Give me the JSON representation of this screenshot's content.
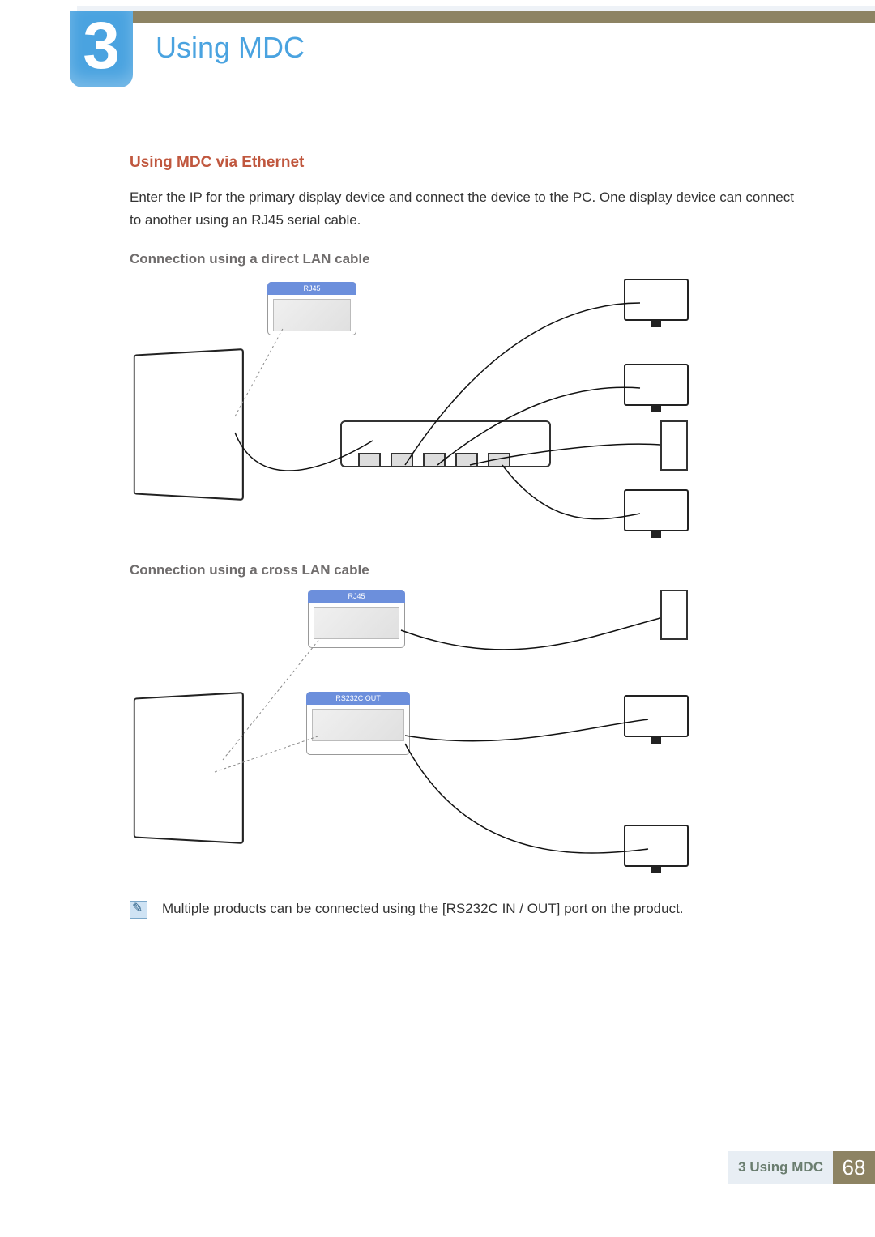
{
  "chapter": {
    "number": "3",
    "title": "Using MDC"
  },
  "section": {
    "heading": "Using MDC via Ethernet",
    "paragraph": "Enter the IP for the primary display device and connect the device to the PC. One display device can connect to another using an RJ45 serial cable.",
    "sub1": "Connection using a direct LAN cable",
    "sub2": "Connection using a cross LAN cable"
  },
  "diagram1": {
    "labels": {
      "rj45": "RJ45"
    }
  },
  "diagram2": {
    "labels": {
      "rj45": "RJ45",
      "rs232c_out": "RS232C OUT"
    }
  },
  "footnote": "Multiple products can be connected using the [RS232C IN / OUT] port on the product.",
  "footer": {
    "breadcrumb_num": "3",
    "breadcrumb_title": "Using MDC",
    "page": "68"
  }
}
